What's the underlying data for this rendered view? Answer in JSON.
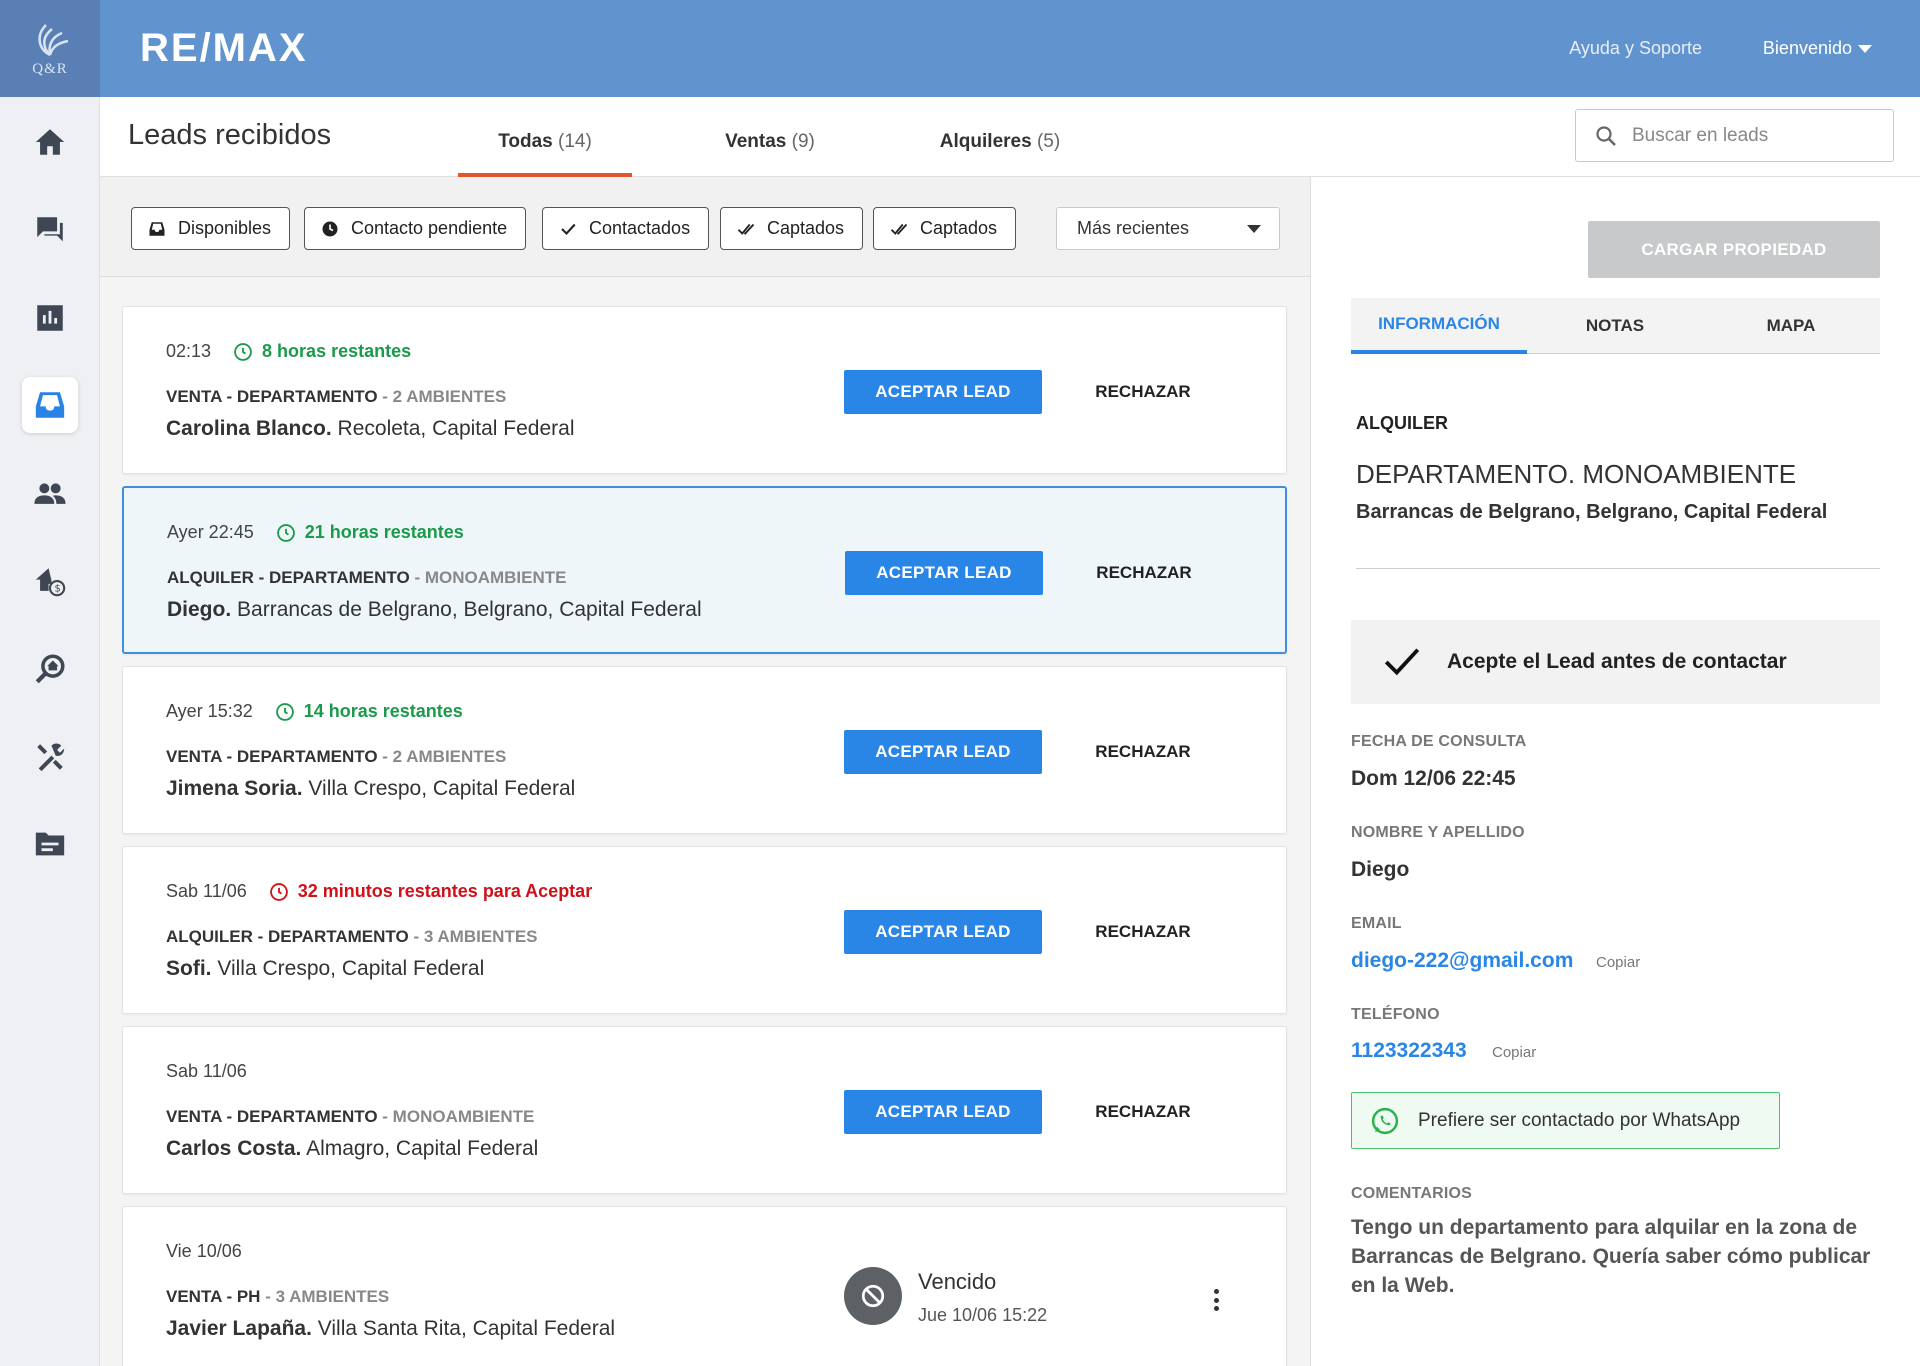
{
  "app": {
    "logo_text": "Q&R",
    "brand": "RE/MAX",
    "help_label": "Ayuda y Soporte",
    "welcome_label": "Bienvenido"
  },
  "sidebar": {
    "items": [
      {
        "icon": "home-icon"
      },
      {
        "icon": "chat-icon"
      },
      {
        "icon": "chart-icon"
      },
      {
        "icon": "inbox-icon",
        "active": true
      },
      {
        "icon": "people-icon"
      },
      {
        "icon": "house-price-icon"
      },
      {
        "icon": "search-house-icon"
      },
      {
        "icon": "tools-icon"
      },
      {
        "icon": "document-icon"
      }
    ]
  },
  "header": {
    "title": "Leads recibidos",
    "tabs": [
      {
        "label": "Todas",
        "count": "(14)",
        "active": true
      },
      {
        "label": "Ventas",
        "count": "(9)"
      },
      {
        "label": "Alquileres",
        "count": "(5)"
      }
    ],
    "search": {
      "placeholder": "Buscar en leads",
      "value": ""
    }
  },
  "filters": {
    "chips": [
      {
        "label": "Disponibles",
        "icon": "inbox-icon"
      },
      {
        "label": "Contacto pendiente",
        "icon": "clock-icon"
      },
      {
        "label": "Contactados",
        "icon": "check-icon"
      },
      {
        "label": "Captados",
        "icon": "double-check-icon"
      },
      {
        "label": "Captados",
        "icon": "double-check-icon"
      }
    ],
    "sort": {
      "selected": "Más recientes"
    }
  },
  "leads": [
    {
      "time": "02:13",
      "timer": "8 horas restantes",
      "timer_status": "green",
      "kind": "VENTA - DEPARTAMENTO",
      "sub": "- 2 AMBIENTES",
      "name": "Carolina Blanco.",
      "location": "Recoleta, Capital Federal",
      "accept": "ACEPTAR LEAD",
      "reject": "RECHAZAR"
    },
    {
      "time": "Ayer 22:45",
      "timer": "21 horas restantes",
      "timer_status": "green",
      "kind": "ALQUILER - DEPARTAMENTO",
      "sub": "- MONOAMBIENTE",
      "name": "Diego.",
      "location": "Barrancas de Belgrano, Belgrano, Capital Federal",
      "accept": "ACEPTAR LEAD",
      "reject": "RECHAZAR",
      "selected": true
    },
    {
      "time": "Ayer 15:32",
      "timer": "14 horas restantes",
      "timer_status": "green",
      "kind": "VENTA - DEPARTAMENTO",
      "sub": "- 2 AMBIENTES",
      "name": "Jimena Soria.",
      "location": "Villa Crespo, Capital Federal",
      "accept": "ACEPTAR LEAD",
      "reject": "RECHAZAR"
    },
    {
      "time": "Sab 11/06",
      "timer": "32 minutos restantes para Aceptar",
      "timer_status": "red",
      "kind": "ALQUILER - DEPARTAMENTO",
      "sub": "- 3 AMBIENTES",
      "name": "Sofi.",
      "location": "Villa Crespo, Capital Federal",
      "accept": "ACEPTAR LEAD",
      "reject": "RECHAZAR"
    },
    {
      "time": "Sab 11/06",
      "timer": "",
      "kind": "VENTA - DEPARTAMENTO",
      "sub": "- MONOAMBIENTE",
      "name": "Carlos Costa.",
      "location": "Almagro, Capital Federal",
      "accept": "ACEPTAR LEAD",
      "reject": "RECHAZAR"
    },
    {
      "time": "Vie 10/06",
      "timer": "",
      "kind": "VENTA - PH",
      "sub": "- 3 AMBIENTES",
      "name": "Javier Lapaña.",
      "location": "Villa Santa Rita, Capital Federal",
      "expired_label": "Vencido",
      "expired_date": "Jue 10/06 15:22"
    }
  ],
  "detail": {
    "load_button": "CARGAR PROPIEDAD",
    "tabs": [
      {
        "label": "INFORMACIÓN",
        "active": true
      },
      {
        "label": "NOTAS"
      },
      {
        "label": "MAPA"
      }
    ],
    "operation": "ALQUILER",
    "property": "DEPARTAMENTO. MONOAMBIENTE",
    "address": "Barrancas de Belgrano, Belgrano, Capital Federal",
    "notice": "Acepte el Lead antes de contactar",
    "date_label": "FECHA DE CONSULTA",
    "date_value": "Dom 12/06 22:45",
    "name_label": "NOMBRE Y APELLIDO",
    "name_value": "Diego",
    "email_label": "EMAIL",
    "email_value": "diego-222@gmail.com",
    "email_copy": "Copiar",
    "phone_label": "TELÉFONO",
    "phone_value": "1123322343",
    "phone_copy": "Copiar",
    "whatsapp": "Prefiere ser contactado por WhatsApp",
    "comments_label": "COMENTARIOS",
    "comments": "Tengo un departamento para alquilar en la zona de Barrancas de Belgrano. Quería saber cómo publicar en la Web."
  },
  "colors": {
    "topbar": "#6194cf",
    "accent": "#2a86e6",
    "tab_indicator": "#e0552b",
    "timer_green": "#1a9a4a",
    "timer_red": "#d0111a",
    "whatsapp_border": "#49c26c"
  }
}
